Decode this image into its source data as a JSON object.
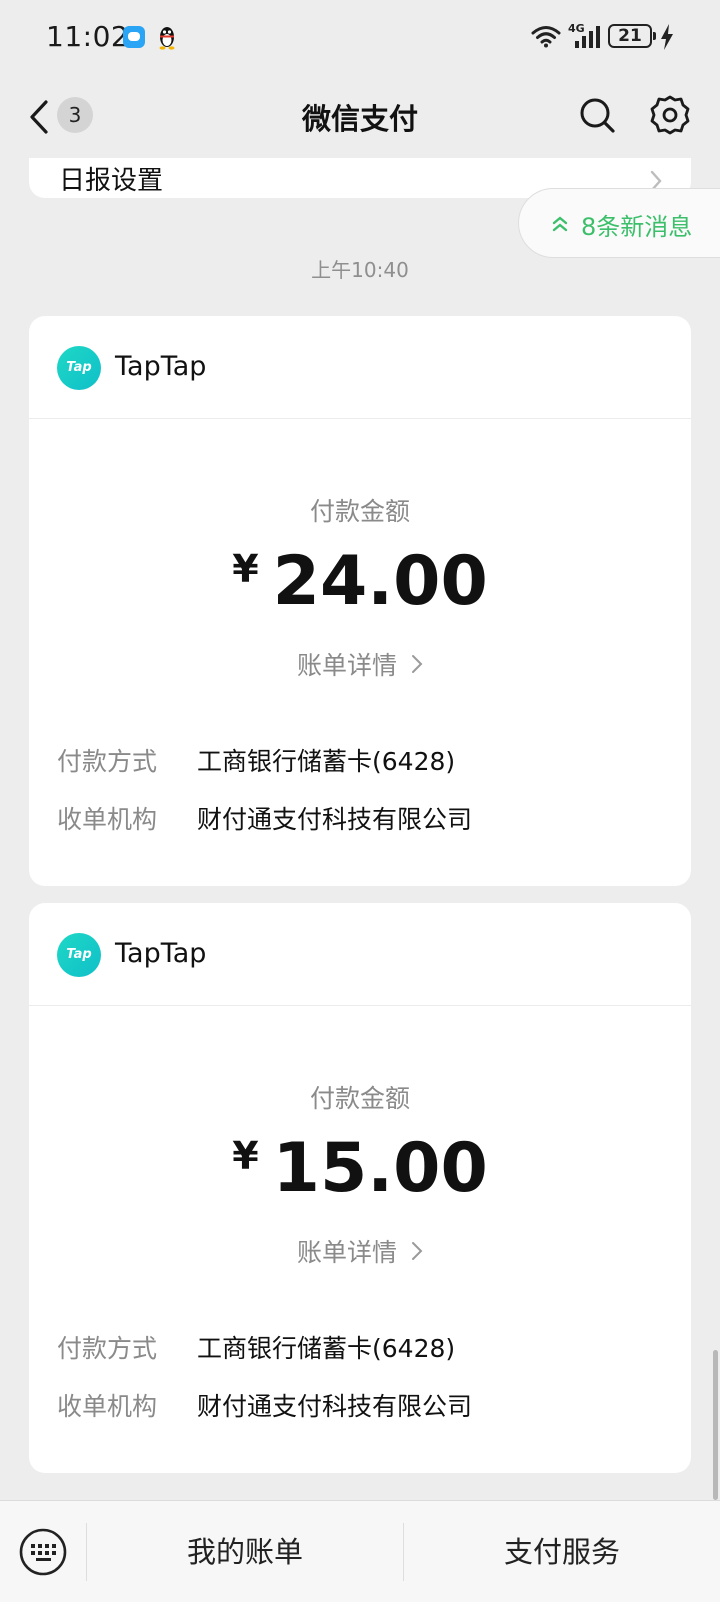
{
  "status_bar": {
    "time": "11:02",
    "network": "4G",
    "battery": "21"
  },
  "header": {
    "back_count": "3",
    "title": "微信支付"
  },
  "previous_card": {
    "label": "日报设置"
  },
  "new_messages": {
    "text": "8条新消息"
  },
  "timestamp": "上午10:40",
  "payments": [
    {
      "merchant": "TapTap",
      "logo_text": "Tap",
      "amount_label": "付款金额",
      "currency": "¥",
      "amount": "24.00",
      "bill_detail": "账单详情",
      "method_label": "付款方式",
      "method_value": "工商银行储蓄卡(6428)",
      "acquirer_label": "收单机构",
      "acquirer_value": "财付通支付科技有限公司"
    },
    {
      "merchant": "TapTap",
      "logo_text": "Tap",
      "amount_label": "付款金额",
      "currency": "¥",
      "amount": "15.00",
      "bill_detail": "账单详情",
      "method_label": "付款方式",
      "method_value": "工商银行储蓄卡(6428)",
      "acquirer_label": "收单机构",
      "acquirer_value": "财付通支付科技有限公司"
    }
  ],
  "bottom_bar": {
    "my_bills": "我的账单",
    "pay_services": "支付服务"
  },
  "colors": {
    "accent_green": "#3cbf6a",
    "background": "#ededed",
    "tap_teal": "#10bfc9"
  }
}
